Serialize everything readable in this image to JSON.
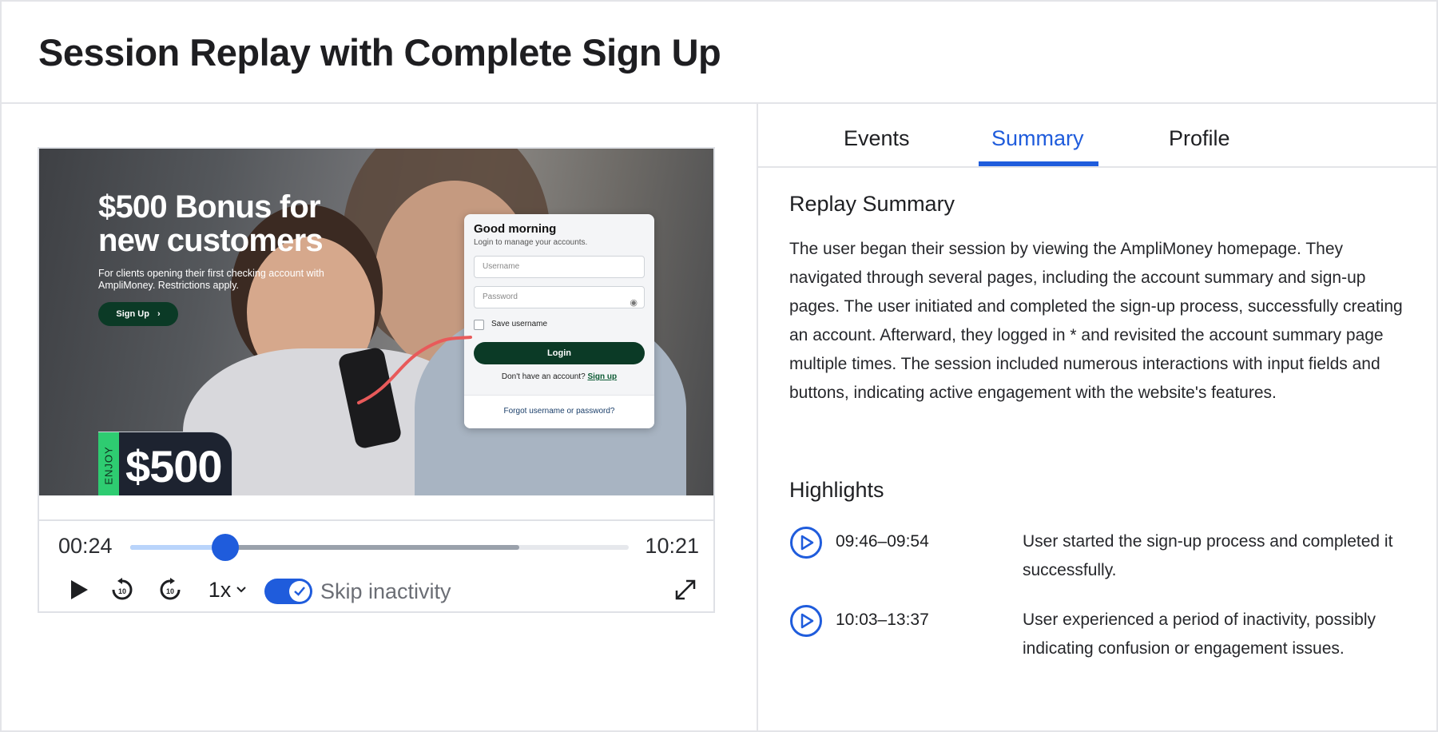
{
  "page": {
    "title": "Session Replay with Complete Sign Up"
  },
  "video": {
    "ad_headline_line1": "$500 Bonus for",
    "ad_headline_line2": "new customers",
    "ad_sub": "For clients opening their first checking account with AmpliMoney. Restrictions apply.",
    "ad_signup": "Sign Up",
    "bonus_enjoy": "ENJOY",
    "bonus_amount": "$500",
    "login": {
      "title": "Good morning",
      "subtitle": "Login to manage your accounts.",
      "username_placeholder": "Username",
      "password_placeholder": "Password",
      "save_username": "Save username",
      "login_button": "Login",
      "no_account": "Don't have an account?",
      "sign_up_link": "Sign up",
      "forgot": "Forgot username or password?"
    }
  },
  "player": {
    "current_time": "00:24",
    "total_time": "10:21",
    "progress": 0.19,
    "buffered": 0.78,
    "speed": "1x",
    "skip_inactivity_label": "Skip inactivity",
    "skip_inactivity_on": true,
    "skip_back_seconds": "10",
    "skip_forward_seconds": "10",
    "accent_color": "#1f5cdc"
  },
  "tabs": [
    {
      "label": "Events",
      "active": false
    },
    {
      "label": "Summary",
      "active": true
    },
    {
      "label": "Profile",
      "active": false
    }
  ],
  "summary": {
    "title": "Replay Summary",
    "text": "The user began their session by viewing the AmpliMoney homepage. They navigated through several pages, including the account summary and sign-up pages. The user initiated and completed the sign-up process, successfully creating an account. Afterward, they logged in * and revisited the account summary page multiple times. The session included numerous interactions with input fields and buttons, indicating active engagement with the website's features."
  },
  "highlights": {
    "title": "Highlights",
    "items": [
      {
        "time": "09:46–09:54",
        "description": "User started the sign-up process and completed it successfully."
      },
      {
        "time": "10:03–13:37",
        "description": "User experienced a period of inactivity, possibly indicating confusion or engagement issues."
      }
    ]
  }
}
